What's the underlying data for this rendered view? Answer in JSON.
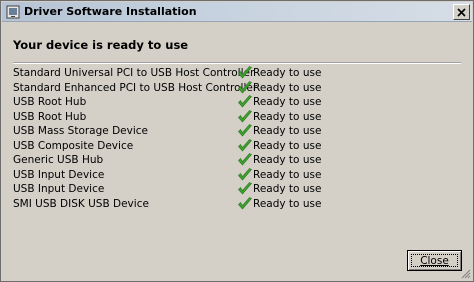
{
  "window": {
    "title": "Driver Software Installation",
    "heading": "Your device is ready to use"
  },
  "devices": [
    {
      "name": "Standard Universal PCI to USB Host Controller",
      "status": "Ready to use"
    },
    {
      "name": "Standard Enhanced PCI to USB Host Controller",
      "status": "Ready to use"
    },
    {
      "name": "USB Root Hub",
      "status": "Ready to use"
    },
    {
      "name": "USB Root Hub",
      "status": "Ready to use"
    },
    {
      "name": "USB Mass Storage Device",
      "status": "Ready to use"
    },
    {
      "name": "USB Composite Device",
      "status": "Ready to use"
    },
    {
      "name": "Generic USB Hub",
      "status": "Ready to use"
    },
    {
      "name": "USB Input Device",
      "status": "Ready to use"
    },
    {
      "name": "USB Input Device",
      "status": "Ready to use"
    },
    {
      "name": "SMI USB DISK USB Device",
      "status": "Ready to use"
    }
  ],
  "buttons": {
    "close_label": "Close"
  },
  "colors": {
    "check": "#3fa02f",
    "dialog_bg": "#d4d0c8"
  },
  "icons": {
    "title": "device-icon",
    "status": "green-checkmark-icon",
    "window_close": "close-x-icon"
  }
}
